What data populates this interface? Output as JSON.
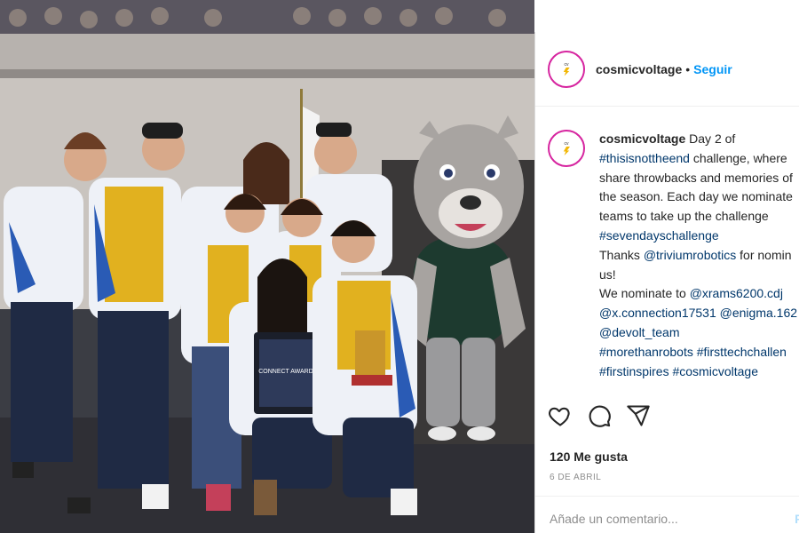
{
  "post": {
    "username": "cosmicvoltage",
    "separator": "•",
    "follow_label": "Seguir"
  },
  "caption": {
    "username": "cosmicvoltage",
    "lines": [
      [
        {
          "t": "Day 2 of",
          "link": false
        }
      ],
      [
        {
          "t": "#thisisnottheend",
          "link": true
        },
        {
          "t": " challenge, where",
          "link": false
        }
      ],
      [
        {
          "t": "share throwbacks and memories of",
          "link": false
        }
      ],
      [
        {
          "t": "the season. Each day we nominate",
          "link": false
        }
      ],
      [
        {
          "t": "teams to take up the challenge",
          "link": false
        }
      ],
      [
        {
          "t": "#sevendayschallenge",
          "link": true
        }
      ],
      [
        {
          "t": "Thanks ",
          "link": false
        },
        {
          "t": "@triviumrobotics",
          "link": true
        },
        {
          "t": " for nomin",
          "link": false
        }
      ],
      [
        {
          "t": "us!",
          "link": false
        }
      ],
      [
        {
          "t": "We nominate to ",
          "link": false
        },
        {
          "t": "@xrams6200.cdj",
          "link": true
        }
      ],
      [
        {
          "t": "@x.connection17531",
          "link": true
        },
        {
          "t": " ",
          "link": false
        },
        {
          "t": "@enigma.162",
          "link": true
        }
      ],
      [
        {
          "t": "@devolt_team",
          "link": true
        }
      ],
      [
        {
          "t": "#morethanrobots",
          "link": true
        },
        {
          "t": " ",
          "link": false
        },
        {
          "t": "#firsttechchallen",
          "link": true
        }
      ],
      [
        {
          "t": "#firstinspires",
          "link": true
        },
        {
          "t": " ",
          "link": false
        },
        {
          "t": "#cosmicvoltage",
          "link": true
        }
      ]
    ]
  },
  "likes_text": "120 Me gusta",
  "date_text": "6 DE ABRIL",
  "comment": {
    "placeholder": "Añade un comentario...",
    "publish_label": "Pu"
  },
  "photo": {
    "plaque_title": "CONNECT AWARD",
    "colors": {
      "jacket": "#eef1f7",
      "jacket_blue": "#2a5bb5",
      "shirt": "#e1b11f",
      "pants": "#1f2a44",
      "stage": "#2f2f35",
      "wall": "#c9c4bf"
    }
  },
  "icons": [
    "heart-icon",
    "comment-icon",
    "share-icon"
  ]
}
